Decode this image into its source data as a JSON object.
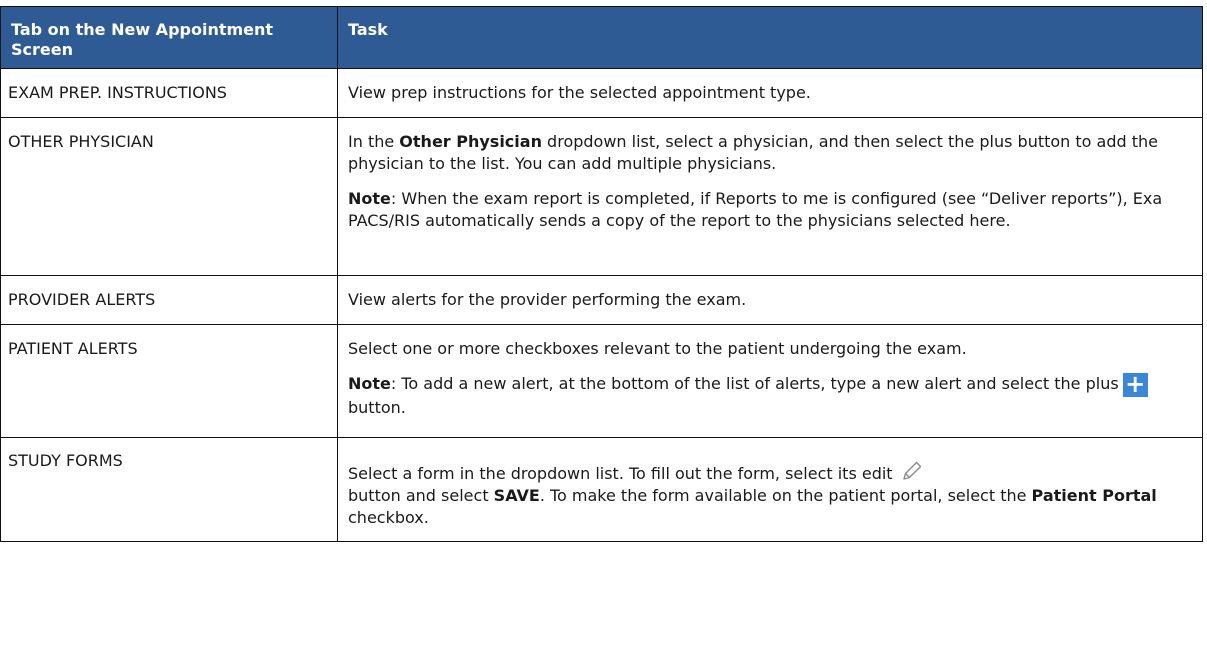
{
  "table": {
    "headers": [
      "Tab on the New Appointment Screen",
      "Task"
    ],
    "rows": {
      "exam_prep": {
        "tab": "EXAM PREP. INSTRUCTIONS",
        "task": "View prep instructions for the selected appointment type."
      },
      "other_physician": {
        "tab": "OTHER PHYSICIAN",
        "p1_pre": "In the ",
        "p1_bold": "Other Physician",
        "p1_post": " dropdown list, select a physician, and then select the plus button to add the physician to the list. You can add multiple physicians.",
        "note_label": "Note",
        "note_text": ": When the exam report is completed, if Reports to me is configured (see “Deliver reports”), Exa PACS/RIS automatically sends a copy of the report to the physicians selected here."
      },
      "provider_alerts": {
        "tab": "PROVIDER ALERTS",
        "task": "View alerts for the provider performing the exam."
      },
      "patient_alerts": {
        "tab": "PATIENT ALERTS",
        "p1": "Select one or more checkboxes relevant to the patient undergoing the exam.",
        "note_label": "Note",
        "note_text": ": To add a new alert, at the bottom of the list of alerts, type a new alert and select the plus",
        "plus_symbol": "+",
        "note_end": "button."
      },
      "study_forms": {
        "tab": "STUDY FORMS",
        "t1": "Select a form in the dropdown list. To fill out the form, select its edit",
        "t2": "button and select ",
        "save": "SAVE",
        "t3": ". To make the form available on the patient portal, select the ",
        "portal": "Patient Portal",
        "t4": " checkbox."
      }
    }
  },
  "colors": {
    "header_bg": "#2f5b94",
    "plus_btn": "#3a86d8"
  },
  "icons": {
    "plus": "plus-icon",
    "edit": "pencil-icon"
  }
}
